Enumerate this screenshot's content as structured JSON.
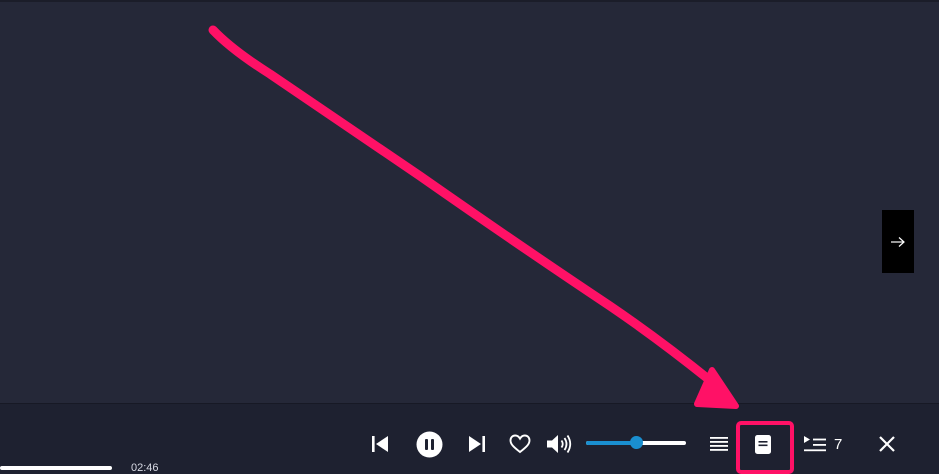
{
  "player": {
    "elapsed_time": "02:46",
    "progress_fraction": 0.08,
    "volume_fraction": 0.5,
    "queue_count": "7"
  },
  "icons": {
    "next_panel": "arrow-right-icon",
    "previous": "skip-previous-icon",
    "play_pause": "pause-icon",
    "next": "skip-next-icon",
    "favorite": "heart-outline-icon",
    "volume": "volume-high-icon",
    "lyrics": "text-lines-icon",
    "book": "book-icon",
    "queue": "playlist-play-icon",
    "close": "close-icon"
  },
  "colors": {
    "background": "#252838",
    "player_bar": "#1e2130",
    "accent": "#1a8fd0",
    "annotation": "#ff1166",
    "icon": "#ffffff"
  }
}
